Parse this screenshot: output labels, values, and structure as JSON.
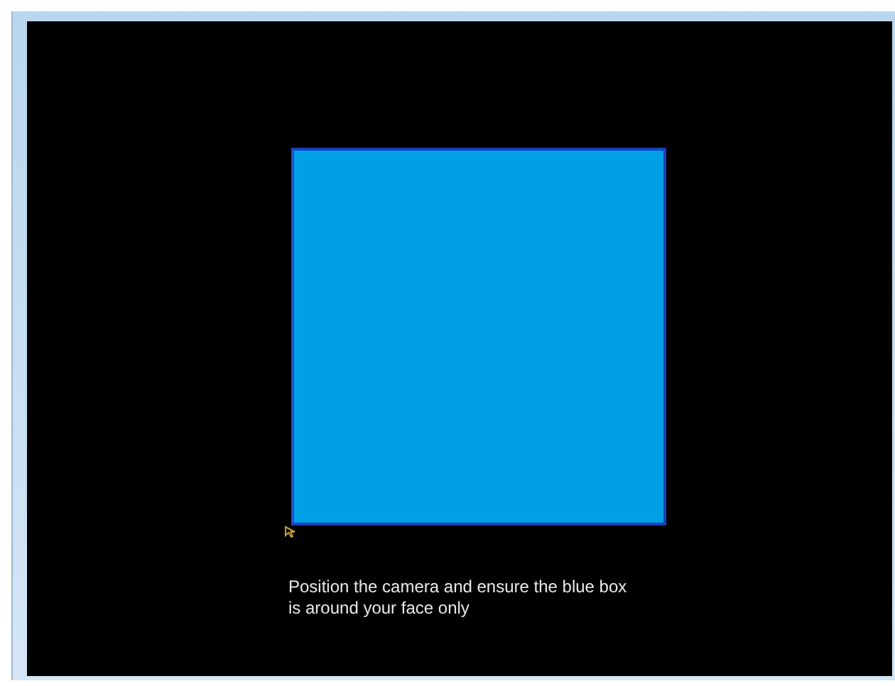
{
  "instruction": "Position the camera and ensure the blue box\nis around your face only"
}
